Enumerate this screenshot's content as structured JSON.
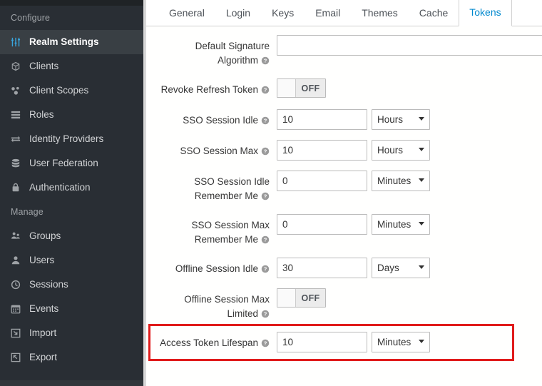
{
  "sidebar": {
    "sections": [
      {
        "title": "Configure",
        "items": [
          {
            "label": "Realm Settings",
            "icon": "sliders-icon",
            "active": true
          },
          {
            "label": "Clients",
            "icon": "cube-icon",
            "active": false
          },
          {
            "label": "Client Scopes",
            "icon": "molecule-icon",
            "active": false
          },
          {
            "label": "Roles",
            "icon": "list-bars-icon",
            "active": false
          },
          {
            "label": "Identity Providers",
            "icon": "exchange-arrows-icon",
            "active": false
          },
          {
            "label": "User Federation",
            "icon": "database-icon",
            "active": false
          },
          {
            "label": "Authentication",
            "icon": "lock-icon",
            "active": false
          }
        ]
      },
      {
        "title": "Manage",
        "items": [
          {
            "label": "Groups",
            "icon": "users-group-icon",
            "active": false
          },
          {
            "label": "Users",
            "icon": "user-icon",
            "active": false
          },
          {
            "label": "Sessions",
            "icon": "clock-icon",
            "active": false
          },
          {
            "label": "Events",
            "icon": "calendar-icon",
            "active": false
          },
          {
            "label": "Import",
            "icon": "import-arrow-icon",
            "active": false
          },
          {
            "label": "Export",
            "icon": "export-arrow-icon",
            "active": false
          }
        ]
      }
    ]
  },
  "tabs": [
    {
      "label": "General",
      "active": false
    },
    {
      "label": "Login",
      "active": false
    },
    {
      "label": "Keys",
      "active": false
    },
    {
      "label": "Email",
      "active": false
    },
    {
      "label": "Themes",
      "active": false
    },
    {
      "label": "Cache",
      "active": false
    },
    {
      "label": "Tokens",
      "active": true
    }
  ],
  "form": {
    "rows": [
      {
        "label_lines": [
          "Default Signature",
          "Algorithm"
        ],
        "help": true,
        "control": "text-wide",
        "value": "",
        "placeholder": ""
      },
      {
        "label_lines": [
          "Revoke Refresh Token"
        ],
        "help": true,
        "control": "toggle",
        "toggle_state": "OFF"
      },
      {
        "label_lines": [
          "SSO Session Idle"
        ],
        "help": true,
        "control": "number-unit",
        "value": "10",
        "unit": "Hours"
      },
      {
        "label_lines": [
          "SSO Session Max"
        ],
        "help": true,
        "control": "number-unit",
        "value": "10",
        "unit": "Hours"
      },
      {
        "label_lines": [
          "SSO Session Idle",
          "Remember Me"
        ],
        "help": true,
        "control": "number-unit",
        "value": "0",
        "unit": "Minutes"
      },
      {
        "label_lines": [
          "SSO Session Max",
          "Remember Me"
        ],
        "help": true,
        "control": "number-unit",
        "value": "0",
        "unit": "Minutes"
      },
      {
        "label_lines": [
          "Offline Session Idle"
        ],
        "help": true,
        "control": "number-unit",
        "value": "30",
        "unit": "Days"
      },
      {
        "label_lines": [
          "Offline Session Max",
          "Limited"
        ],
        "help": true,
        "control": "toggle",
        "toggle_state": "OFF"
      },
      {
        "label_lines": [
          "Access Token Lifespan"
        ],
        "help": true,
        "control": "number-unit",
        "value": "10",
        "unit": "Minutes",
        "highlighted": true
      }
    ],
    "unit_options": [
      "Minutes",
      "Hours",
      "Days"
    ]
  },
  "annotation": {
    "highlight_color": "#e01b1b",
    "target_row_label": "Access Token Lifespan"
  },
  "theme": {
    "sidebar_bg": "#292e34",
    "sidebar_active_bg": "#393f44",
    "accent_blue": "#0088ce",
    "icon_blue": "#39a5dc"
  }
}
